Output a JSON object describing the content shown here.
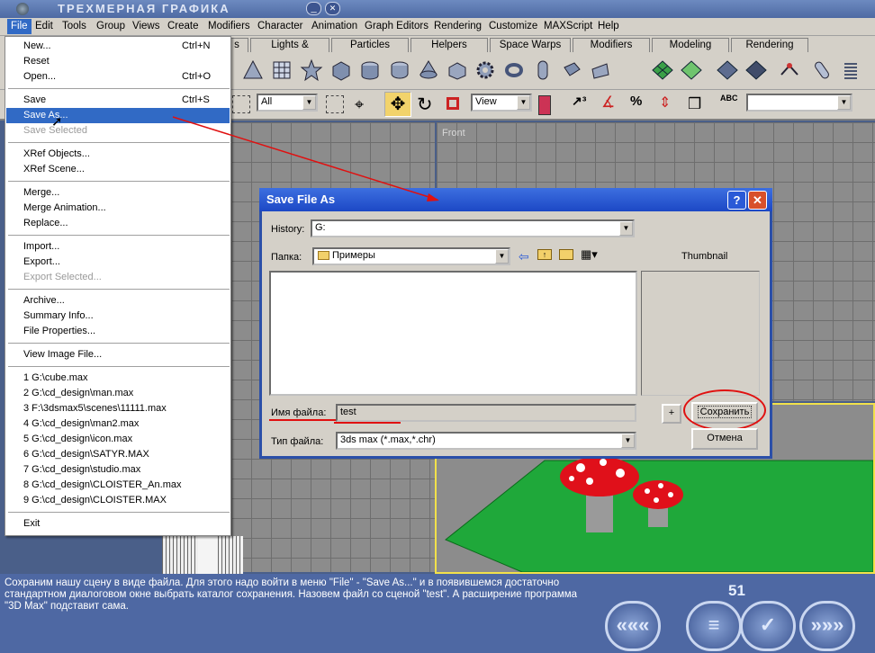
{
  "app": {
    "title": "ТРЕХМЕРНАЯ ГРАФИКА"
  },
  "menubar": [
    "File",
    "Edit",
    "Tools",
    "Group",
    "Views",
    "Create",
    "Modifiers",
    "Character",
    "Animation",
    "Graph Editors",
    "Rendering",
    "Customize",
    "MAXScript",
    "Help"
  ],
  "tabs": [
    "s",
    "Lights & Cameras",
    "Particles",
    "Helpers",
    "Space Warps",
    "Modifiers",
    "Modeling",
    "Rendering"
  ],
  "toolbar": {
    "filter": "All",
    "ref_coord": "View",
    "abc": "ABC"
  },
  "viewport": {
    "front_label": "Front"
  },
  "file_menu": [
    {
      "label": "New...",
      "shortcut": "Ctrl+N"
    },
    {
      "label": "Reset",
      "shortcut": ""
    },
    {
      "label": "Open...",
      "shortcut": "Ctrl+O"
    },
    {
      "label": "Save",
      "shortcut": "Ctrl+S"
    },
    {
      "label": "Save As...",
      "shortcut": ""
    },
    {
      "label": "Save Selected",
      "shortcut": ""
    },
    {
      "label": "XRef Objects...",
      "shortcut": ""
    },
    {
      "label": "XRef Scene...",
      "shortcut": ""
    },
    {
      "label": "Merge...",
      "shortcut": ""
    },
    {
      "label": "Merge Animation...",
      "shortcut": ""
    },
    {
      "label": "Replace...",
      "shortcut": ""
    },
    {
      "label": "Import...",
      "shortcut": ""
    },
    {
      "label": "Export...",
      "shortcut": ""
    },
    {
      "label": "Export Selected...",
      "shortcut": ""
    },
    {
      "label": "Archive...",
      "shortcut": ""
    },
    {
      "label": "Summary Info...",
      "shortcut": ""
    },
    {
      "label": "File Properties...",
      "shortcut": ""
    },
    {
      "label": "View Image File...",
      "shortcut": ""
    },
    {
      "label": "1 G:\\cube.max",
      "shortcut": ""
    },
    {
      "label": "2 G:\\cd_design\\man.max",
      "shortcut": ""
    },
    {
      "label": "3 F:\\3dsmax5\\scenes\\11111.max",
      "shortcut": ""
    },
    {
      "label": "4 G:\\cd_design\\man2.max",
      "shortcut": ""
    },
    {
      "label": "5 G:\\cd_design\\icon.max",
      "shortcut": ""
    },
    {
      "label": "6 G:\\cd_design\\SATYR.MAX",
      "shortcut": ""
    },
    {
      "label": "7 G:\\cd_design\\studio.max",
      "shortcut": ""
    },
    {
      "label": "8 G:\\cd_design\\CLOISTER_An.max",
      "shortcut": ""
    },
    {
      "label": "9 G:\\cd_design\\CLOISTER.MAX",
      "shortcut": ""
    },
    {
      "label": "Exit",
      "shortcut": ""
    }
  ],
  "dialog": {
    "title": "Save File As",
    "help": "?",
    "close": "✕",
    "history_label": "History:",
    "history_value": "G:",
    "folder_label": "Папка:",
    "folder_value": "Примеры",
    "thumbnail_label": "Thumbnail",
    "filename_label": "Имя файла:",
    "filename_value": "test",
    "filetype_label": "Тип файла:",
    "filetype_value": "3ds max (*.max,*.chr)",
    "plus": "+",
    "save": "Сохранить",
    "cancel": "Отмена"
  },
  "caption": "Сохраним нашу сцену в виде файла. Для этого надо войти в меню \"File\" - \"Save As...\" и в появившемся достаточно стандартном диалоговом окне выбрать каталог сохранения. Назовем файл со сценой \"test\". А расширение программа \"3D Max\" подставит сама.",
  "page_number": "51",
  "nav": {
    "prev": "«««",
    "menu": "≡",
    "ok": "✓",
    "next": "»»»"
  },
  "colors": {
    "selection": "#316ac5",
    "annotation": "#e01010",
    "dialog_title": "#1c48c5"
  }
}
